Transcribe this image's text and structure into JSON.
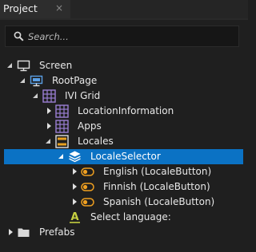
{
  "panel": {
    "tab_title": "Project",
    "close_glyph": "×"
  },
  "search": {
    "placeholder": "Search..."
  },
  "tree": {
    "screen": "Screen",
    "root_page": "RootPage",
    "ivi_grid": "IVI Grid",
    "location_information": "LocationInformation",
    "apps": "Apps",
    "locales": "Locales",
    "locale_selector": "LocaleSelector",
    "english": "English (LocaleButton)",
    "finnish": "Finnish (LocaleButton)",
    "spanish": "Spanish (LocaleButton)",
    "select_language": "Select language:",
    "prefabs": "Prefabs"
  },
  "colors": {
    "selection": "#0b72c4",
    "grid_icon": "#9b7fd4",
    "toggle_icon": "#f0a020",
    "text_icon": "#c6d040"
  }
}
